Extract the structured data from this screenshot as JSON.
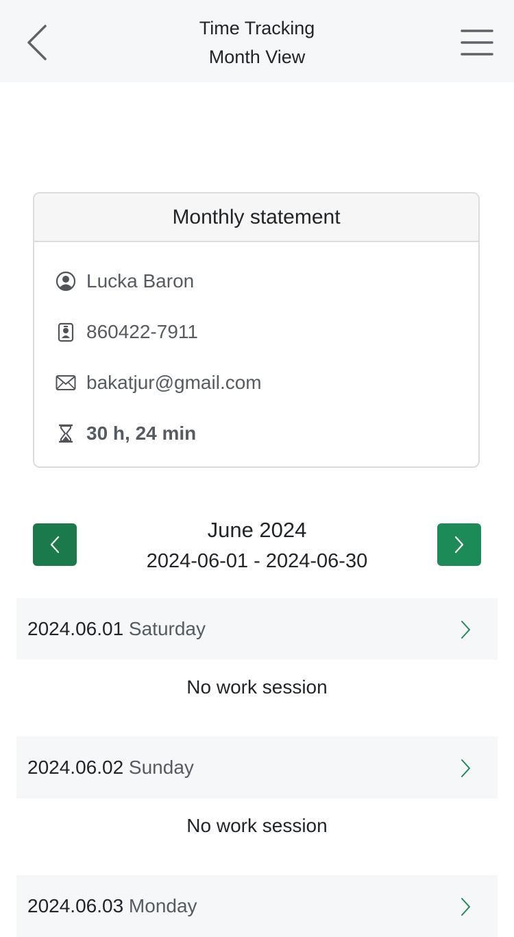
{
  "header": {
    "title": "Time Tracking",
    "subtitle": "Month View",
    "back_icon": "chevron-left-icon",
    "menu_icon": "hamburger-menu-icon"
  },
  "statement": {
    "title": "Monthly statement",
    "name": "Lucka Baron",
    "id_number": "860422-7911",
    "email": "bakatjur@gmail.com",
    "total_time": "30 h, 24 min",
    "icons": [
      "user-circle-icon",
      "id-badge-icon",
      "envelope-icon",
      "hourglass-icon"
    ]
  },
  "month_nav": {
    "month": "June 2024",
    "range": "2024-06-01 - 2024-06-30",
    "prev_icon": "chevron-left-icon",
    "next_icon": "chevron-right-icon"
  },
  "days": [
    {
      "date": "2024.06.01",
      "weekday": "Saturday",
      "status": "No work session"
    },
    {
      "date": "2024.06.02",
      "weekday": "Sunday",
      "status": "No work session"
    },
    {
      "date": "2024.06.03",
      "weekday": "Monday"
    }
  ],
  "colors": {
    "accent_green": "#1d8b57",
    "header_bg": "#f6f7f8",
    "row_bg": "#f6f7f9"
  }
}
